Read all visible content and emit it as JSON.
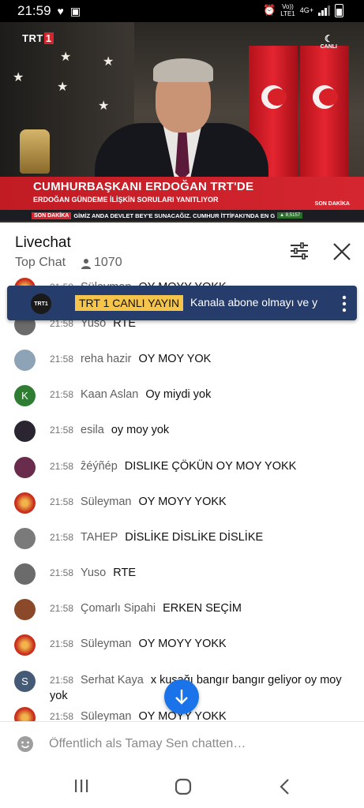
{
  "status_bar": {
    "time": "21:59",
    "network_line1": "Vo))",
    "network_line2": "LTE1",
    "network_type": "4G+"
  },
  "video": {
    "channel_logo": "TRT",
    "channel_logo_num": "1",
    "live_corner_logo": "CANLI",
    "headline": "CUMHURBAŞKANI ERDOĞAN TRT'DE",
    "subheadline": "ERDOĞAN GÜNDEME İLİŞKİN SORULARI YANITLIYOR",
    "corner_badge": "SON DAKİKA",
    "ticker_label": "SON DAKİKA",
    "ticker_text": "GİMİZ ANDA DEVLET BEY'E SUNACAĞIZ. CUMHUR İTTİFAKI'NDA EN G",
    "ticker_stock": "▲ 8,5157"
  },
  "chat_header": {
    "title": "Livechat",
    "mode": "Top Chat",
    "viewer_count": "1070"
  },
  "pinned": {
    "channel_avatar": "TRT1",
    "channel_name": "TRT 1 CANLI YAYIN",
    "text": "Kanala abone olmayı ve y"
  },
  "messages": [
    {
      "time": "21:58",
      "author": "Süleyman",
      "text": "OY MOYY YOKK",
      "avatar": "suleyman-icon",
      "avatar_color": "#c8301e"
    },
    {
      "time": "21:58",
      "author": "Yuso",
      "text": "RTE",
      "avatar": "yuso-icon",
      "avatar_color": "#6b6b6b"
    },
    {
      "time": "21:58",
      "author": "reha hazir",
      "text": "OY MOY YOK",
      "avatar": "reha-icon",
      "avatar_color": "#8fa3b6"
    },
    {
      "time": "21:58",
      "author": "Kaan Aslan",
      "text": "Oy miydi yok",
      "avatar": "K",
      "avatar_color": "#2e7d32"
    },
    {
      "time": "21:58",
      "author": "esila",
      "text": "oy moy yok",
      "avatar": "esila-icon",
      "avatar_color": "#2a2530"
    },
    {
      "time": "21:58",
      "author": "ẑéýñép",
      "text": "DISLIKE ÇÖKÜN OY MOY YOKK",
      "avatar": "zeynep-icon",
      "avatar_color": "#6a2c4c"
    },
    {
      "time": "21:58",
      "author": "Süleyman",
      "text": "OY MOYY YOKK",
      "avatar": "suleyman-icon",
      "avatar_color": "#c8301e"
    },
    {
      "time": "21:58",
      "author": "TAHEP",
      "text": "DİSLİKE DİSLİKE DİSLİKE",
      "avatar": "tahep-icon",
      "avatar_color": "#7a7a7a"
    },
    {
      "time": "21:58",
      "author": "Yuso",
      "text": "RTE",
      "avatar": "yuso-icon",
      "avatar_color": "#6b6b6b"
    },
    {
      "time": "21:58",
      "author": "Çomarlı Sipahi",
      "text": "ERKEN SEÇİM",
      "avatar": "comarli-icon",
      "avatar_color": "#8a4a2a"
    },
    {
      "time": "21:58",
      "author": "Süleyman",
      "text": "OY MOYY YOKK",
      "avatar": "suleyman-icon",
      "avatar_color": "#c8301e"
    },
    {
      "time": "21:58",
      "author": "Serhat Kaya",
      "text": "x kuşağı bangır bangır geliyor oy moy yok",
      "avatar": "S",
      "avatar_color": "#455a75"
    },
    {
      "time": "21:58",
      "author": "Süleyman",
      "text": "OY MOYY YOKK",
      "avatar": "suleyman-icon",
      "avatar_color": "#c8301e"
    }
  ],
  "input": {
    "placeholder": "Öffentlich als Tamay Sen chatten…"
  },
  "colors": {
    "pinned_bg": "#263c6b",
    "pinned_badge": "#f5c44b",
    "scroll_button": "#1a73e8",
    "lower_third": "#d52630"
  }
}
